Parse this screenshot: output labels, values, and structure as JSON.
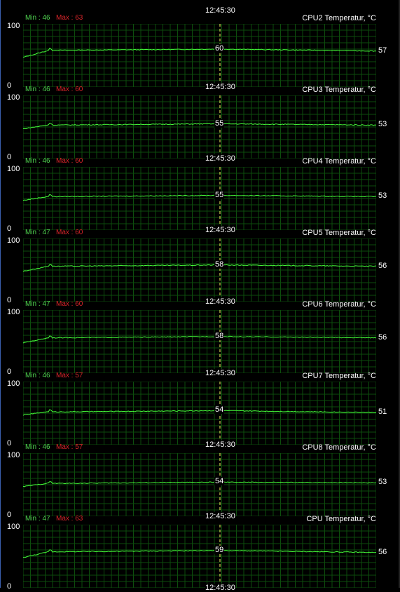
{
  "cursor_time": "12:45:30",
  "colors": {
    "grid": "#0d4d0d",
    "line": "#46ff3a",
    "cursor": "#ffff66",
    "min": "#4fd24f",
    "max": "#d9252a"
  },
  "graphs": [
    {
      "title": "CPU2 Temperatur, °C",
      "ymax": "100",
      "ymin": "0",
      "min": "Min : 46",
      "max": "Max : 63",
      "current": "57",
      "cursor_value": "60"
    },
    {
      "title": "CPU3 Temperatur, °C",
      "ymax": "100",
      "ymin": "0",
      "min": "Min : 46",
      "max": "Max : 60",
      "current": "53",
      "cursor_value": "55"
    },
    {
      "title": "CPU4 Temperatur, °C",
      "ymax": "100",
      "ymin": "0",
      "min": "Min : 46",
      "max": "Max : 60",
      "current": "53",
      "cursor_value": "55"
    },
    {
      "title": "CPU5 Temperatur, °C",
      "ymax": "100",
      "ymin": "0",
      "min": "Min : 47",
      "max": "Max : 60",
      "current": "56",
      "cursor_value": "58"
    },
    {
      "title": "CPU6 Temperatur, °C",
      "ymax": "100",
      "ymin": "0",
      "min": "Min : 47",
      "max": "Max : 60",
      "current": "56",
      "cursor_value": "58"
    },
    {
      "title": "CPU7 Temperatur, °C",
      "ymax": "100",
      "ymin": "0",
      "min": "Min : 46",
      "max": "Max : 57",
      "current": "51",
      "cursor_value": "54"
    },
    {
      "title": "CPU8 Temperatur, °C",
      "ymax": "100",
      "ymin": "0",
      "min": "Min : 46",
      "max": "Max : 57",
      "current": "53",
      "cursor_value": "54"
    },
    {
      "title": "CPU Temperatur, °C",
      "ymax": "100",
      "ymin": "0",
      "min": "Min : 47",
      "max": "Max : 63",
      "current": "56",
      "cursor_value": "59"
    }
  ]
}
